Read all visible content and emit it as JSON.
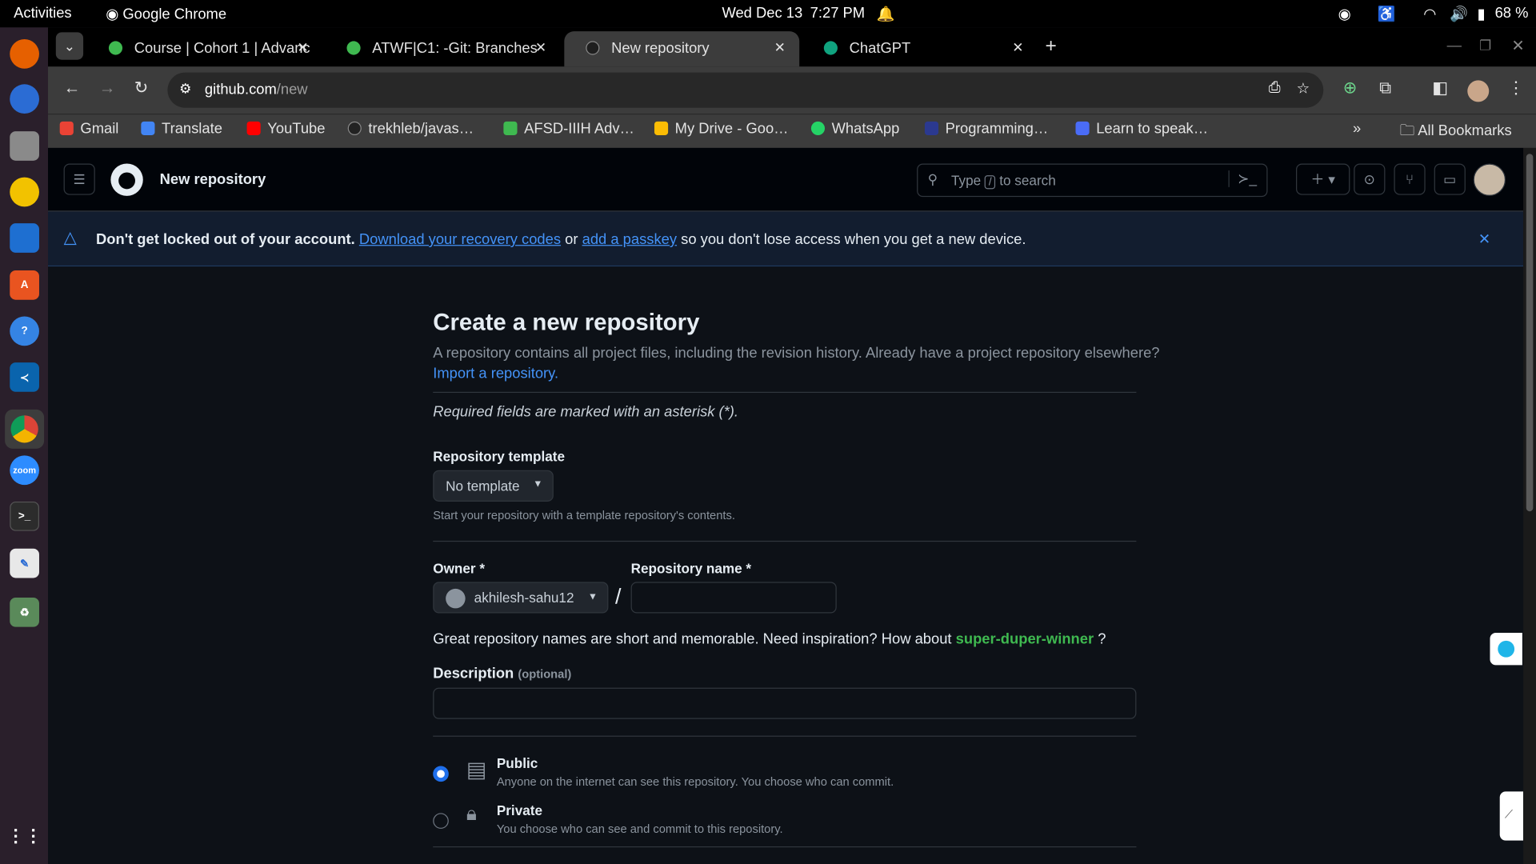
{
  "system": {
    "activities": "Activities",
    "app": "Google Chrome",
    "date": "Wed Dec 13",
    "time": "7:27 PM",
    "battery": "68 %"
  },
  "tabs": [
    {
      "label": "Course | Cohort 1 | Advanc"
    },
    {
      "label": "ATWF|C1: -Git: Branches"
    },
    {
      "label": "New repository"
    },
    {
      "label": "ChatGPT"
    }
  ],
  "address": {
    "host": "github.com",
    "path": "/new"
  },
  "bookmarks": [
    "Gmail",
    "Translate",
    "YouTube",
    "trekhleb/javas…",
    "AFSD-IIIH Adv…",
    "My Drive - Goo…",
    "WhatsApp",
    "Programming…",
    "Learn to speak…"
  ],
  "all_bookmarks": "All Bookmarks",
  "header": {
    "title": "New repository",
    "search_type": "Type",
    "search_key": "/",
    "search_suffix": "to search"
  },
  "banner": {
    "bold": "Don't get locked out of your account.",
    "link1": "Download your recovery codes",
    "or": "or",
    "link2": "add a passkey",
    "tail": "so you don't lose access when you get a new device."
  },
  "form": {
    "title": "Create a new repository",
    "subtitle": "A repository contains all project files, including the revision history. Already have a project repository elsewhere?",
    "import_link": "Import a repository.",
    "required_note": "Required fields are marked with an asterisk (*).",
    "template_label": "Repository template",
    "template_value": "No template",
    "template_help": "Start your repository with a template repository's contents.",
    "owner_label": "Owner *",
    "owner_value": "akhilesh-sahu12",
    "slash": "/",
    "name_label": "Repository name *",
    "name_value": "",
    "inspiration": "Great repository names are short and memorable. Need inspiration? How about",
    "suggestion": "super-duper-winner",
    "q": "?",
    "desc_label": "Description",
    "desc_optional": "(optional)",
    "public_label": "Public",
    "public_desc": "Anyone on the internet can see this repository. You choose who can commit.",
    "private_label": "Private",
    "private_desc": "You choose who can see and commit to this repository.",
    "visibility": "public"
  },
  "colors": {
    "accent": "#4493f8",
    "suggestion": "#3fb950",
    "bg": "#0d1117"
  }
}
